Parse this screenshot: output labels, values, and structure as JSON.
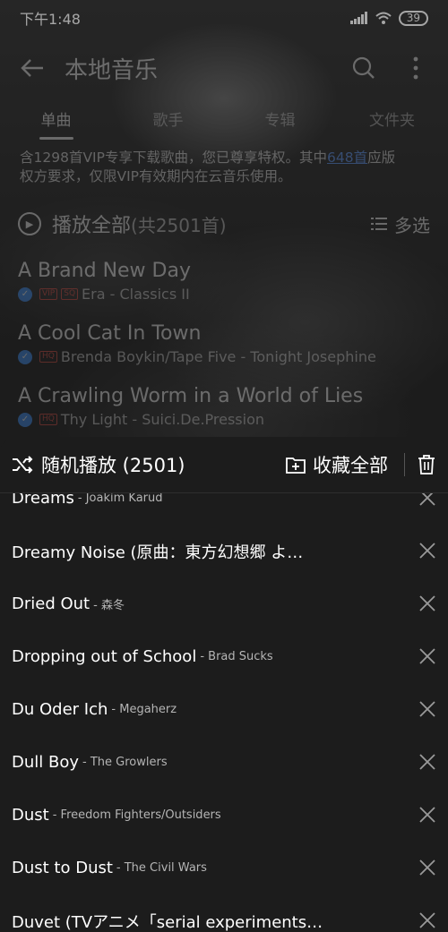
{
  "status": {
    "time": "下午1:48",
    "battery": "39"
  },
  "header": {
    "title": "本地音乐"
  },
  "tabs": [
    {
      "label": "单曲"
    },
    {
      "label": "歌手"
    },
    {
      "label": "专辑"
    },
    {
      "label": "文件夹"
    }
  ],
  "notice": {
    "line1_pre": "含1298首VIP专享下载歌曲，您已尊享特权。其中",
    "link": "648首",
    "line1_post": "应版",
    "line2": "权方要求，仅限VIP有效期内在云音乐使用。"
  },
  "play_all": {
    "label": "播放全部",
    "count": "(共2501首)",
    "multiselect": "多选"
  },
  "background_songs": [
    {
      "title": "A Brand New Day",
      "subtitle": "Era - Classics II",
      "tags": [
        "VIP",
        "SQ"
      ]
    },
    {
      "title": "A Cool Cat In Town",
      "subtitle": "Brenda Boykin/Tape Five - Tonight Josephine",
      "tags": [
        "HQ"
      ]
    },
    {
      "title": "A Crawling Worm in a World of Lies",
      "subtitle": "Thy Light - Suici.De.Pression",
      "tags": [
        "HQ"
      ]
    }
  ],
  "sheet": {
    "shuffle_label": "随机播放 (2501)",
    "collect_label": "收藏全部",
    "songs": [
      {
        "name": "Dreams",
        "artist": "- Joakim Karud"
      },
      {
        "name": "Dreamy Noise (原曲：東方幻想郷 よ…",
        "artist": ""
      },
      {
        "name": "Dried Out",
        "artist": "- 森冬"
      },
      {
        "name": "Dropping out of School",
        "artist": "- Brad Sucks"
      },
      {
        "name": "Du Oder Ich",
        "artist": "- Megaherz"
      },
      {
        "name": "Dull Boy",
        "artist": "- The Growlers"
      },
      {
        "name": "Dust",
        "artist": "- Freedom Fighters/Outsiders"
      },
      {
        "name": "Dust to Dust",
        "artist": "- The Civil Wars"
      },
      {
        "name": "Duvet (TVアニメ「serial experiments…",
        "artist": ""
      }
    ]
  }
}
